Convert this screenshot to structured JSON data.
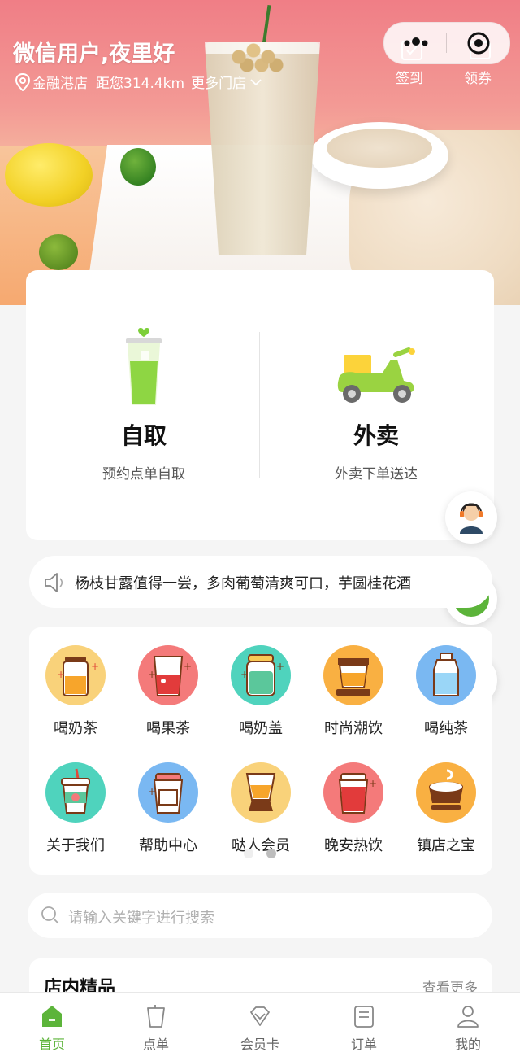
{
  "header": {
    "greeting": "微信用户,夜里好",
    "store_name": "金融港店",
    "distance": "距您314.4km",
    "more_stores": "更多门店",
    "checkin_label": "签到",
    "coupon_label": "领券"
  },
  "services": [
    {
      "title": "自取",
      "subtitle": "预约点单自取"
    },
    {
      "title": "外卖",
      "subtitle": "外卖下单送达"
    }
  ],
  "notice": {
    "text": "杨枝甘露值得一尝，多肉葡萄清爽可口，芋圆桂花酒"
  },
  "categories": [
    {
      "label": "喝奶茶",
      "icon": "milk-tea-icon",
      "color": "#f9d27a"
    },
    {
      "label": "喝果茶",
      "icon": "fruit-tea-icon",
      "color": "#f47a7a"
    },
    {
      "label": "喝奶盖",
      "icon": "cheese-foam-icon",
      "color": "#4fd3bd"
    },
    {
      "label": "时尚潮饮",
      "icon": "trendy-drink-icon",
      "color": "#f9b042"
    },
    {
      "label": "喝纯茶",
      "icon": "pure-tea-icon",
      "color": "#7ab8f2"
    },
    {
      "label": "关于我们",
      "icon": "about-us-icon",
      "color": "#4fd3bd"
    },
    {
      "label": "帮助中心",
      "icon": "help-center-icon",
      "color": "#7ab8f2"
    },
    {
      "label": "哒人会员",
      "icon": "member-icon",
      "color": "#f9d27a"
    },
    {
      "label": "晚安热饮",
      "icon": "hot-drink-icon",
      "color": "#f47a7a"
    },
    {
      "label": "镇店之宝",
      "icon": "signature-drink-icon",
      "color": "#f9b042"
    }
  ],
  "search": {
    "placeholder": "请输入关键字进行搜索"
  },
  "picks": {
    "title": "店内精品",
    "more": "查看更多"
  },
  "tabbar": [
    {
      "label": "首页",
      "icon": "home-icon",
      "active": true
    },
    {
      "label": "点单",
      "icon": "cup-icon",
      "active": false
    },
    {
      "label": "会员卡",
      "icon": "member-card-icon",
      "active": false
    },
    {
      "label": "订单",
      "icon": "order-icon",
      "active": false
    },
    {
      "label": "我的",
      "icon": "user-icon",
      "active": false
    }
  ],
  "colors": {
    "accent": "#5cb43a",
    "banner": "#f07e86"
  }
}
